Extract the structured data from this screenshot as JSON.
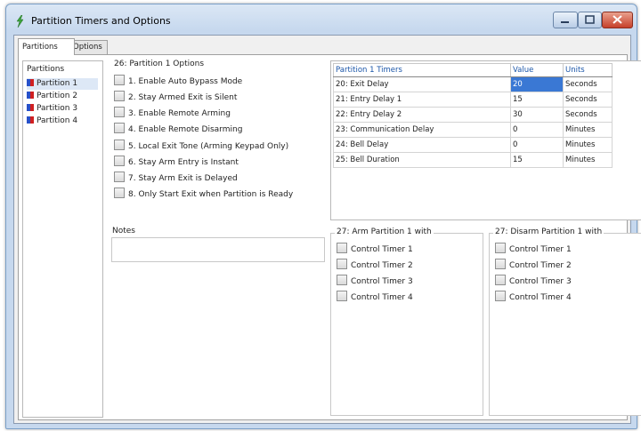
{
  "window": {
    "title": "Partition Timers and Options"
  },
  "tabs": [
    {
      "label": "Partitions"
    },
    {
      "label": "Options"
    }
  ],
  "partitions": {
    "header": "Partitions",
    "items": [
      {
        "label": "Partition 1"
      },
      {
        "label": "Partition 2"
      },
      {
        "label": "Partition 3"
      },
      {
        "label": "Partition 4"
      }
    ]
  },
  "options": {
    "title": "26: Partition 1 Options",
    "items": [
      {
        "label": "1. Enable Auto Bypass Mode",
        "checked": false
      },
      {
        "label": "2. Stay Armed Exit is Silent",
        "checked": false
      },
      {
        "label": "3. Enable Remote Arming",
        "checked": false
      },
      {
        "label": "4. Enable Remote Disarming",
        "checked": false
      },
      {
        "label": "5. Local Exit Tone (Arming Keypad Only)",
        "checked": false
      },
      {
        "label": "6. Stay Arm Entry is Instant",
        "checked": false
      },
      {
        "label": "7. Stay Arm Exit is Delayed",
        "checked": false
      },
      {
        "label": "8. Only Start Exit when Partition is Ready",
        "checked": false
      }
    ]
  },
  "timers": {
    "headers": {
      "name": "Partition 1 Timers",
      "value": "Value",
      "units": "Units"
    },
    "rows": [
      {
        "name": "20: Exit Delay",
        "value": "20",
        "units": "Seconds"
      },
      {
        "name": "21: Entry Delay 1",
        "value": "15",
        "units": "Seconds"
      },
      {
        "name": "22: Entry Delay 2",
        "value": "30",
        "units": "Seconds"
      },
      {
        "name": "23: Communication Delay",
        "value": "0",
        "units": "Minutes"
      },
      {
        "name": "24: Bell Delay",
        "value": "0",
        "units": "Minutes"
      },
      {
        "name": "25: Bell Duration",
        "value": "15",
        "units": "Minutes"
      }
    ]
  },
  "notes": {
    "label": "Notes",
    "value": ""
  },
  "arm_group": {
    "title": "27: Arm Partition 1 with",
    "items": [
      {
        "label": "Control Timer 1"
      },
      {
        "label": "Control Timer 2"
      },
      {
        "label": "Control Timer 3"
      },
      {
        "label": "Control Timer 4"
      }
    ]
  },
  "disarm_group": {
    "title": "27: Disarm Partition 1 with",
    "items": [
      {
        "label": "Control Timer 1"
      },
      {
        "label": "Control Timer 2"
      },
      {
        "label": "Control Timer 3"
      },
      {
        "label": "Control Timer 4"
      }
    ]
  }
}
